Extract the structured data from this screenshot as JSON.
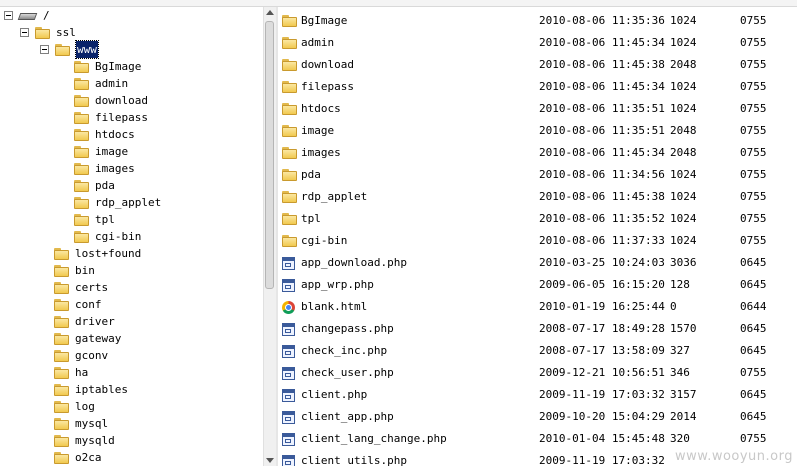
{
  "tree": {
    "root": {
      "label": "/"
    },
    "ssl": {
      "label": "ssl"
    },
    "www": {
      "label": "www"
    },
    "www_children": [
      "BgImage",
      "admin",
      "download",
      "filepass",
      "htdocs",
      "image",
      "images",
      "pda",
      "rdp_applet",
      "tpl",
      "cgi-bin"
    ],
    "ssl_children": [
      "lost+found",
      "bin",
      "certs",
      "conf",
      "driver",
      "gateway",
      "gconv",
      "ha",
      "iptables",
      "log",
      "mysql",
      "mysqld",
      "o2ca"
    ]
  },
  "files": [
    {
      "name": "BgImage",
      "date": "2010-08-06 11:35:36",
      "size": "1024",
      "perm": "0755",
      "icon": "folder-icon"
    },
    {
      "name": "admin",
      "date": "2010-08-06 11:45:34",
      "size": "1024",
      "perm": "0755",
      "icon": "folder-icon"
    },
    {
      "name": "download",
      "date": "2010-08-06 11:45:38",
      "size": "2048",
      "perm": "0755",
      "icon": "folder-icon"
    },
    {
      "name": "filepass",
      "date": "2010-08-06 11:45:34",
      "size": "1024",
      "perm": "0755",
      "icon": "folder-icon"
    },
    {
      "name": "htdocs",
      "date": "2010-08-06 11:35:51",
      "size": "1024",
      "perm": "0755",
      "icon": "folder-icon"
    },
    {
      "name": "image",
      "date": "2010-08-06 11:35:51",
      "size": "2048",
      "perm": "0755",
      "icon": "folder-icon"
    },
    {
      "name": "images",
      "date": "2010-08-06 11:45:34",
      "size": "2048",
      "perm": "0755",
      "icon": "folder-icon"
    },
    {
      "name": "pda",
      "date": "2010-08-06 11:34:56",
      "size": "1024",
      "perm": "0755",
      "icon": "folder-icon"
    },
    {
      "name": "rdp_applet",
      "date": "2010-08-06 11:45:38",
      "size": "1024",
      "perm": "0755",
      "icon": "folder-icon"
    },
    {
      "name": "tpl",
      "date": "2010-08-06 11:35:52",
      "size": "1024",
      "perm": "0755",
      "icon": "folder-icon"
    },
    {
      "name": "cgi-bin",
      "date": "2010-08-06 11:37:33",
      "size": "1024",
      "perm": "0755",
      "icon": "folder-icon"
    },
    {
      "name": "app_download.php",
      "date": "2010-03-25 10:24:03",
      "size": "3036",
      "perm": "0645",
      "icon": "php-file-icon"
    },
    {
      "name": "app_wrp.php",
      "date": "2009-06-05 16:15:20",
      "size": "128",
      "perm": "0645",
      "icon": "php-file-icon"
    },
    {
      "name": "blank.html",
      "date": "2010-01-19 16:25:44",
      "size": "0",
      "perm": "0644",
      "icon": "chrome-html-icon"
    },
    {
      "name": "changepass.php",
      "date": "2008-07-17 18:49:28",
      "size": "1570",
      "perm": "0645",
      "icon": "php-file-icon"
    },
    {
      "name": "check_inc.php",
      "date": "2008-07-17 13:58:09",
      "size": "327",
      "perm": "0645",
      "icon": "php-file-icon"
    },
    {
      "name": "check_user.php",
      "date": "2009-12-21 10:56:51",
      "size": "346",
      "perm": "0755",
      "icon": "php-file-icon"
    },
    {
      "name": "client.php",
      "date": "2009-11-19 17:03:32",
      "size": "3157",
      "perm": "0645",
      "icon": "php-file-icon"
    },
    {
      "name": "client_app.php",
      "date": "2009-10-20 15:04:29",
      "size": "2014",
      "perm": "0645",
      "icon": "php-file-icon"
    },
    {
      "name": "client_lang_change.php",
      "date": "2010-01-04 15:45:48",
      "size": "320",
      "perm": "0755",
      "icon": "php-file-icon"
    },
    {
      "name": "client_utils.php",
      "date": "2009-11-19 17:03:32",
      "size": "",
      "perm": "",
      "icon": "php-file-icon"
    }
  ],
  "watermark": "www.wooyun.org"
}
